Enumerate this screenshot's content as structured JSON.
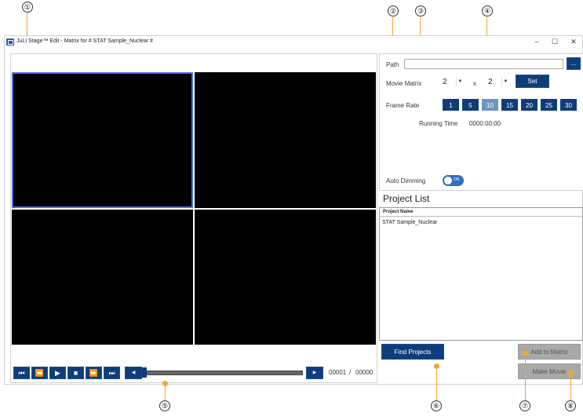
{
  "window": {
    "title": "JuLI Stage™ Edit - Matrix for # STAT Sample_Nuclear #",
    "minimize": "–",
    "maximize": "☐",
    "close": "✕"
  },
  "callouts": [
    "①",
    "②",
    "③",
    "④",
    "⑤",
    "⑥",
    "⑦",
    "⑧"
  ],
  "settings": {
    "path_label": "Path",
    "path_value": "",
    "browse_label": "...",
    "matrix_label": "Movie Matrix",
    "matrix_rows": "2",
    "matrix_x": "x",
    "matrix_cols": "2",
    "set_label": "Set",
    "frame_rate_label": "Frame Rate",
    "frame_rates": [
      "1",
      "5",
      "10",
      "15",
      "20",
      "25",
      "30"
    ],
    "frame_rate_selected": "10",
    "running_time_label": "Running Time",
    "running_time_value": "0000:00:00",
    "auto_dimming_label": "Auto Dimming",
    "auto_dimming_state": "ON"
  },
  "project_list": {
    "title": "Project List",
    "column_header": "Project Name",
    "rows": [
      "STAT Sample_Nuclear"
    ]
  },
  "actions": {
    "find_projects": "Find Projects",
    "add_to_matrix": "Add to Matrix",
    "make_movie": "Make Movie"
  },
  "playback": {
    "current_frame": "00001",
    "separator": "/",
    "total_frames": "00000",
    "progress": 0.0
  },
  "colors": {
    "accent": "#0f3d7a",
    "selection": "#4a6fd8",
    "callout": "#f0a830",
    "disabled": "#a9a9a9"
  }
}
